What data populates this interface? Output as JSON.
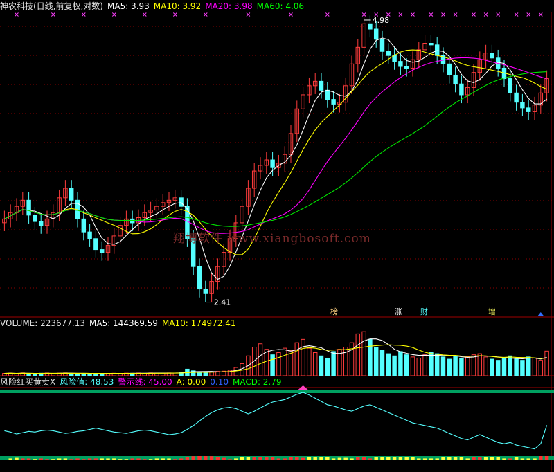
{
  "header": {
    "title": "神农科技(日线,前复权,对数)",
    "ma5": "MA5: 3.93",
    "ma10": "MA10: 3.92",
    "ma20": "MA20: 3.98",
    "ma60": "MA60: 4.06"
  },
  "volume_header": {
    "volume": "VOLUME: 223677.13",
    "ma5": "MA5: 144369.59",
    "ma10": "MA10: 174972.41"
  },
  "indicator_header": {
    "name": "风险红买黄卖X",
    "risk": "风险值: 48.53",
    "warning": "警示线: 45.00",
    "a": "A: 0.00",
    "zero": "0.10",
    "macd": "MACD: 2.79"
  },
  "annotations": {
    "high": "4.98",
    "low": "2.41",
    "watermark": "翔博软件  www.xiangbosoft.com"
  },
  "events": [
    "榜",
    "涨",
    "财",
    "增"
  ],
  "colors": {
    "up": "#ff3c3c",
    "down": "#54ffff",
    "ma5": "#ffffff",
    "ma10": "#ffff00",
    "ma20": "#ff00ff",
    "ma60": "#00e600",
    "grid": "#8b0000",
    "risk": "#54ffff",
    "warning_band": "#00a060"
  },
  "chart_data": [
    {
      "type": "candlestick",
      "title": "神农科技(日线,前复权,对数)",
      "y_scale": "log",
      "ylim": [
        2.3,
        5.1
      ],
      "annotated_high": 4.98,
      "annotated_low": 2.41,
      "series": [
        {
          "name": "MA5",
          "last": 3.93
        },
        {
          "name": "MA10",
          "last": 3.92
        },
        {
          "name": "MA20",
          "last": 3.98
        },
        {
          "name": "MA60",
          "last": 4.06
        }
      ],
      "close_trend": [
        2.95,
        3.0,
        3.05,
        3.1,
        2.98,
        2.93,
        2.9,
        2.95,
        3.0,
        3.12,
        3.2,
        3.1,
        2.95,
        2.85,
        2.8,
        2.72,
        2.7,
        2.75,
        2.82,
        2.9,
        2.95,
        2.92,
        2.96,
        3.0,
        3.02,
        3.05,
        3.08,
        3.1,
        3.12,
        3.05,
        2.8,
        2.6,
        2.45,
        2.42,
        2.5,
        2.6,
        2.7,
        2.8,
        2.92,
        3.05,
        3.2,
        3.35,
        3.4,
        3.45,
        3.38,
        3.42,
        3.5,
        3.7,
        3.95,
        4.1,
        4.2,
        4.25,
        4.15,
        4.05,
        4.0,
        4.02,
        4.2,
        4.45,
        4.65,
        4.95,
        4.88,
        4.75,
        4.6,
        4.55,
        4.48,
        4.42,
        4.4,
        4.5,
        4.62,
        4.7,
        4.68,
        4.55,
        4.45,
        4.32,
        4.22,
        4.1,
        4.18,
        4.35,
        4.5,
        4.58,
        4.52,
        4.4,
        4.28,
        4.12,
        4.02,
        3.96,
        3.92,
        3.99,
        4.12,
        4.28
      ]
    },
    {
      "type": "bar",
      "title": "VOLUME",
      "series": [
        {
          "name": "VOLUME",
          "last": 223677.13
        },
        {
          "name": "MA5",
          "last": 144369.59
        },
        {
          "name": "MA10",
          "last": 174972.41
        }
      ],
      "volume_trend": [
        22000,
        24000,
        20000,
        26000,
        21000,
        19000,
        23000,
        25000,
        22000,
        24000,
        26000,
        21000,
        20000,
        22000,
        19000,
        18000,
        21000,
        20000,
        23000,
        22000,
        24000,
        23000,
        25000,
        22000,
        26000,
        25000,
        24000,
        26000,
        25000,
        30000,
        60000,
        45000,
        30000,
        28000,
        35000,
        40000,
        42000,
        50000,
        75000,
        110000,
        180000,
        260000,
        290000,
        240000,
        190000,
        210000,
        250000,
        230000,
        300000,
        330000,
        250000,
        210000,
        180000,
        160000,
        220000,
        240000,
        260000,
        300000,
        380000,
        400000,
        330000,
        260000,
        230000,
        200000,
        180000,
        220000,
        190000,
        170000,
        160000,
        190000,
        210000,
        200000,
        170000,
        150000,
        180000,
        160000,
        170000,
        190000,
        200000,
        170000,
        150000,
        140000,
        160000,
        180000,
        150000,
        140000,
        170000,
        160000,
        140000,
        223677
      ]
    },
    {
      "type": "line",
      "title": "风险红买黄卖X",
      "series": [
        {
          "name": "风险值",
          "last": 48.53
        },
        {
          "name": "警示线",
          "last": 45.0
        },
        {
          "name": "A",
          "last": 0.0
        },
        {
          "name": "MACD",
          "last": 2.79
        }
      ],
      "risk_trend": [
        40,
        38,
        35,
        37,
        39,
        38,
        40,
        41,
        40,
        38,
        36,
        37,
        39,
        40,
        42,
        44,
        42,
        40,
        38,
        37,
        36,
        38,
        40,
        41,
        40,
        38,
        36,
        34,
        35,
        37,
        42,
        48,
        55,
        62,
        68,
        72,
        75,
        76,
        74,
        70,
        66,
        70,
        75,
        80,
        84,
        86,
        88,
        92,
        96,
        99,
        95,
        90,
        85,
        80,
        78,
        75,
        72,
        70,
        74,
        78,
        80,
        76,
        72,
        68,
        64,
        60,
        56,
        52,
        50,
        48,
        46,
        44,
        40,
        36,
        32,
        28,
        26,
        30,
        34,
        30,
        26,
        22,
        20,
        22,
        18,
        16,
        14,
        12,
        20,
        48.53
      ]
    }
  ]
}
